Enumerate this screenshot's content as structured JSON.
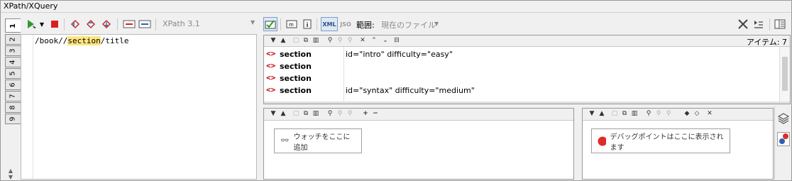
{
  "window": {
    "title": "XPath/XQuery"
  },
  "toolbar": {
    "xpath_version": "XPath 3.1",
    "scope_label": "範囲:",
    "scope_value": "現在のファイル",
    "xml_label": "XML",
    "json_label": "JSO"
  },
  "tabs": [
    "1",
    "2",
    "3",
    "4",
    "5",
    "6",
    "7",
    "8",
    "9"
  ],
  "editor": {
    "expr_prefix": "/book//",
    "expr_highlight": "section",
    "expr_suffix": "/title"
  },
  "results": {
    "count_label": "アイテム: 7",
    "rows": [
      {
        "name": "section",
        "attrs": "id=\"intro\" difficulty=\"easy\""
      },
      {
        "name": "section",
        "attrs": ""
      },
      {
        "name": "section",
        "attrs": ""
      },
      {
        "name": "section",
        "attrs": "id=\"syntax\" difficulty=\"medium\""
      }
    ]
  },
  "watch": {
    "placeholder": "ウォッチをここに追加"
  },
  "breakpoints": {
    "placeholder": "デバッグポイントはここに表示されます"
  },
  "colors": {
    "accent_red": "#d82020",
    "tag_red": "#c00000",
    "highlight": "#ffe680"
  }
}
